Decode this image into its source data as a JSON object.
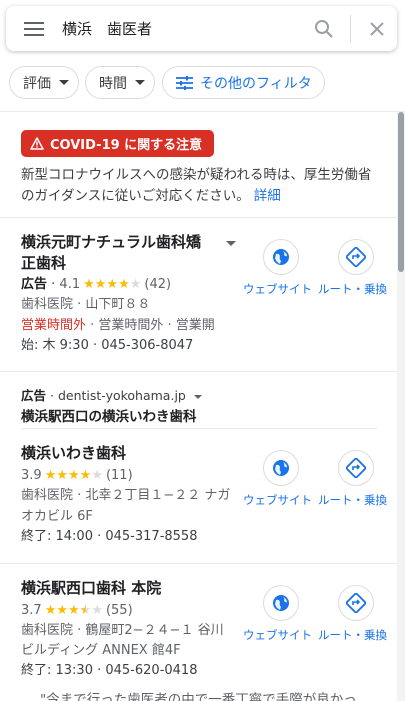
{
  "search": {
    "query": "横浜　歯医者"
  },
  "chips": {
    "rating": "評価",
    "hours": "時間",
    "more_filters": "その他のフィルタ"
  },
  "covid": {
    "badge": "COVID-19 に関する注意",
    "text": "新型コロナウイルスへの感染が疑われる時は、厚生労働省のガイダンスに従いご対応ください。",
    "link": "詳細"
  },
  "actions": {
    "website": "ウェブサイト",
    "route": "ルート・乗換"
  },
  "listings": [
    {
      "title_line1": "横浜元町ナチュラル歯科矯",
      "title_line2": "正歯科",
      "ad_label": "広告",
      "rating": "4.1",
      "stars_full": "★★★★",
      "stars_empty": "★",
      "reviews": "(42)",
      "category_address": "歯科医院 · 山下町８８",
      "status_closed": "営業時間外",
      "status_rest": " · 営業時間外 · 営業開",
      "hours_phone": "始: 木 9:30 · 045-306-8047"
    },
    {
      "title_line1": "横浜いわき歯科",
      "rating": "3.9",
      "stars_full": "★★★★",
      "stars_empty": "★",
      "reviews": "(11)",
      "category_address": "歯科医院 · 北幸２丁目１−２２ ナガ",
      "address_line2": "オカビル 6F",
      "hours_phone": "終了: 14:00 · 045-317-8558"
    },
    {
      "title_line1": "横浜駅西口歯科 本院",
      "rating": "3.7",
      "stars_full": "★★★",
      "stars_half": "★",
      "stars_empty": "★",
      "reviews": "(55)",
      "category_address": "歯科医院 · 鶴屋町2−２４−１ 谷川",
      "address_line2": "ビルディング ANNEX 館4F",
      "hours_phone": "終了: 13:30 · 045-620-0418"
    }
  ],
  "ad_block": {
    "ad_label": "広告",
    "domain": "dentist-yokohama.jp",
    "title": "横浜駅西口の横浜いわき歯科"
  },
  "review_snippet": "\"今まで行った歯医者の中で一番丁寧で手際が良かっ",
  "colors": {
    "accent": "#1a73e8",
    "alert": "#d93025",
    "star": "#fbbc04"
  }
}
